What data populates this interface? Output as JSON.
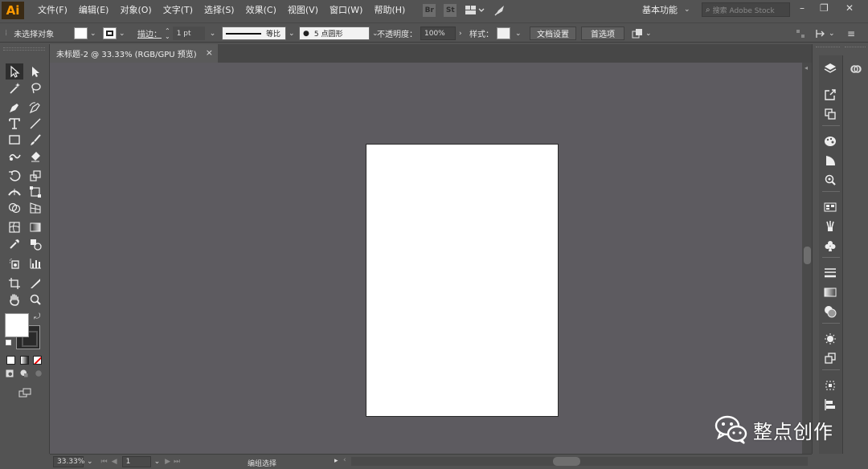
{
  "app": {
    "logo": "Ai"
  },
  "menu": [
    "文件(F)",
    "编辑(E)",
    "对象(O)",
    "文字(T)",
    "选择(S)",
    "效果(C)",
    "视图(V)",
    "窗口(W)",
    "帮助(H)"
  ],
  "menubar_icons": {
    "bridge": "Br",
    "stock": "St"
  },
  "workspace": {
    "label": "基本功能"
  },
  "stock_search": {
    "placeholder": "搜索 Adobe Stock"
  },
  "control_bar": {
    "selection_status": "未选择对象",
    "stroke_label": "描边：",
    "stroke_weight": "1 pt",
    "profile_label": "等比",
    "brush_label": "5 点圆形",
    "opacity_label": "不透明度：",
    "opacity_value": "100%",
    "style_label": "样式：",
    "doc_setup_button": "文档设置",
    "preferences_button": "首选项"
  },
  "document_tab": {
    "title": "未标题-2 @ 33.33% (RGB/GPU 预览)"
  },
  "status_bar": {
    "zoom": "33.33%",
    "artboard_number": "1",
    "tool_status": "编组选择"
  },
  "watermark": {
    "text": "整点创作"
  },
  "colors": {
    "ui_bg": "#535353",
    "canvas_bg": "#5d5b60",
    "artboard": "#ffffff",
    "ai_logo_fg": "#ff9a00",
    "ai_logo_bg": "#3a2a14"
  }
}
